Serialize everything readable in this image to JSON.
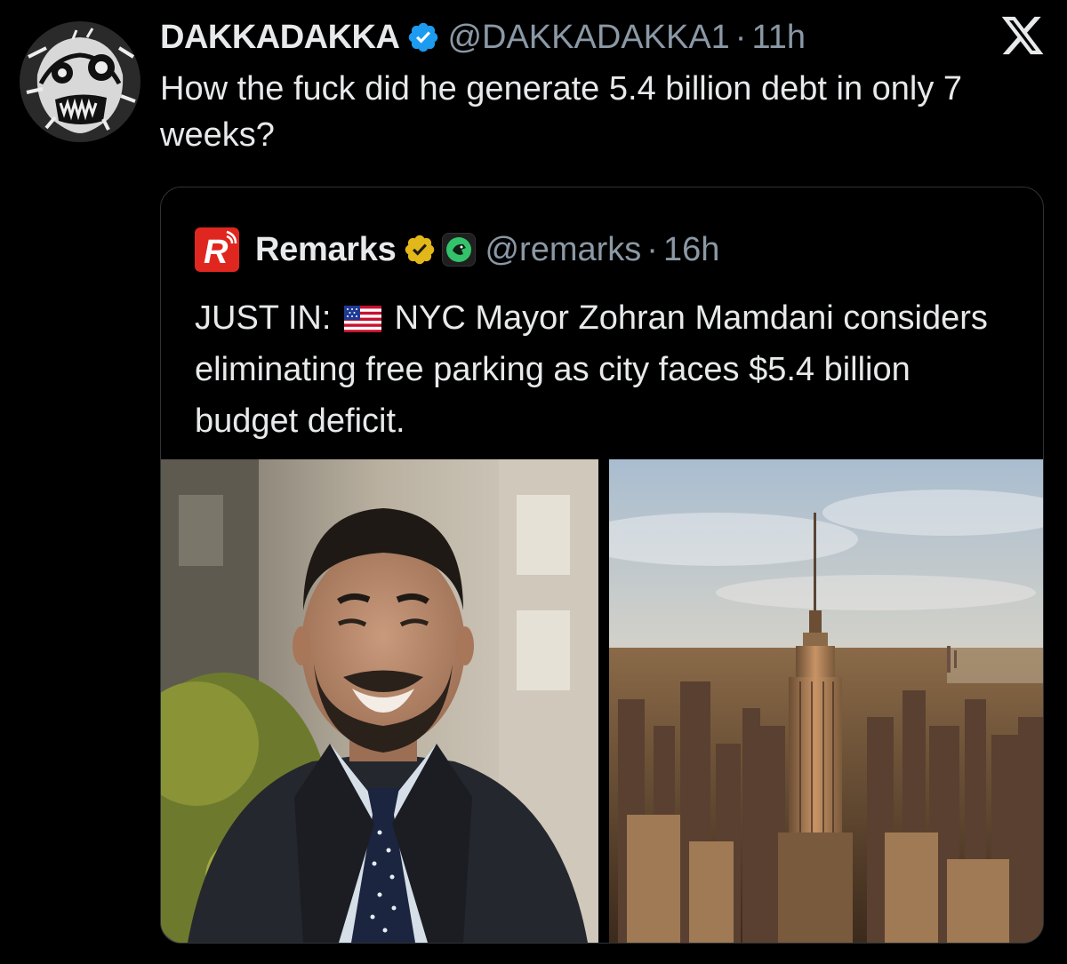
{
  "tweet": {
    "author": {
      "display_name": "DAKKADAKKA",
      "handle": "@DAKKADAKKA1",
      "separator": "·",
      "time": "11h",
      "verified": true,
      "avatar_icon": "zombie-face-avatar-icon"
    },
    "text": "How the fuck did he generate 5.4 billion debt in only 7 weeks?",
    "platform_icon": "x-logo-icon"
  },
  "quoted_tweet": {
    "author": {
      "display_name": "Remarks",
      "handle": "@remarks",
      "separator": "·",
      "time": "16h",
      "logo_icon": "remarks-r-logo-icon",
      "badge_icon": "gold-verified-icon",
      "affiliate_icon": "affiliate-badge-icon"
    },
    "text_prefix": "JUST IN:",
    "flag_icon": "us-flag-icon",
    "text_body": "NYC Mayor Zohran Mamdani considers eliminating free parking as city faces $5.4 billion budget deficit.",
    "media": [
      {
        "name": "portrait-photo",
        "description_icon": "man-in-suit-photo"
      },
      {
        "name": "skyline-photo",
        "description_icon": "empire-state-skyline-photo"
      }
    ]
  },
  "colors": {
    "background": "#000000",
    "text_primary": "#e7e9ea",
    "text_secondary": "#8b98a5",
    "border": "#2f3336",
    "verified_blue": "#1d9bf0",
    "verified_gold": "#e2b719",
    "remarks_red": "#e0271f"
  }
}
